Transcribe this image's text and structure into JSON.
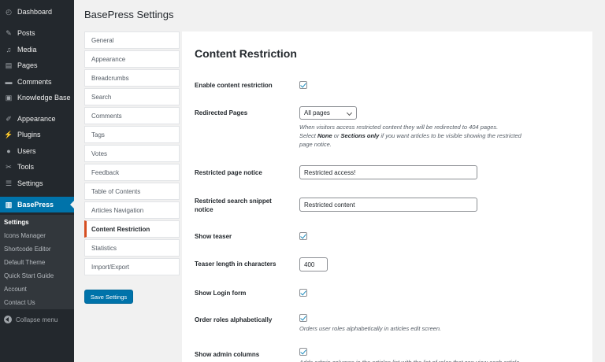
{
  "admin_menu": {
    "items": [
      {
        "label": "Dashboard",
        "icon": "dashboard-icon"
      },
      {
        "label": "Posts",
        "icon": "pin-icon"
      },
      {
        "label": "Media",
        "icon": "media-icon"
      },
      {
        "label": "Pages",
        "icon": "pages-icon"
      },
      {
        "label": "Comments",
        "icon": "comment-icon"
      },
      {
        "label": "Knowledge Base",
        "icon": "knowledge-base-icon"
      },
      {
        "label": "Appearance",
        "icon": "brush-icon"
      },
      {
        "label": "Plugins",
        "icon": "plugin-icon"
      },
      {
        "label": "Users",
        "icon": "users-icon"
      },
      {
        "label": "Tools",
        "icon": "wrench-icon"
      },
      {
        "label": "Settings",
        "icon": "sliders-icon"
      },
      {
        "label": "BasePress",
        "icon": "book-icon"
      }
    ],
    "submenu": [
      "Settings",
      "Icons Manager",
      "Shortcode Editor",
      "Default Theme",
      "Quick Start Guide",
      "Account",
      "Contact Us"
    ],
    "collapse_label": "Collapse menu"
  },
  "page": {
    "title": "BasePress Settings"
  },
  "settings_nav": [
    "General",
    "Appearance",
    "Breadcrumbs",
    "Search",
    "Comments",
    "Tags",
    "Votes",
    "Feedback",
    "Table of Contents",
    "Articles Navigation",
    "Content Restriction",
    "Statistics",
    "Import/Export"
  ],
  "save_button": "Save Settings",
  "content": {
    "title": "Content Restriction",
    "enable_label": "Enable content restriction",
    "redirected_label": "Redirected Pages",
    "redirected_value": "All pages",
    "redirected_desc_1": "When visitors access restricted content they will be redirected to 404 pages.",
    "redirected_desc_2a": "Select ",
    "redirected_desc_none": "None",
    "redirected_desc_2b": " or ",
    "redirected_desc_sections": "Sections only",
    "redirected_desc_2c": " if you want articles to be visible showing the restricted",
    "redirected_desc_3": "page notice.",
    "notice_label": "Restricted page notice",
    "notice_value": "Restricted access!",
    "snippet_label": "Restricted search snippet notice",
    "snippet_value": "Restricted content",
    "teaser_label": "Show teaser",
    "teaser_length_label": "Teaser length in characters",
    "teaser_length_value": "400",
    "login_label": "Show Login form",
    "order_label": "Order roles alphabetically",
    "order_desc": "Orders user roles alphabetically in articles edit screen.",
    "admin_cols_label": "Show admin columns",
    "admin_cols_desc": "Adds admin columns in the articles list with the list of roles that can view each article."
  },
  "colors": {
    "sidebar": "#23282d",
    "accent": "#0073aa",
    "active_tab_marker": "#d54e21"
  }
}
